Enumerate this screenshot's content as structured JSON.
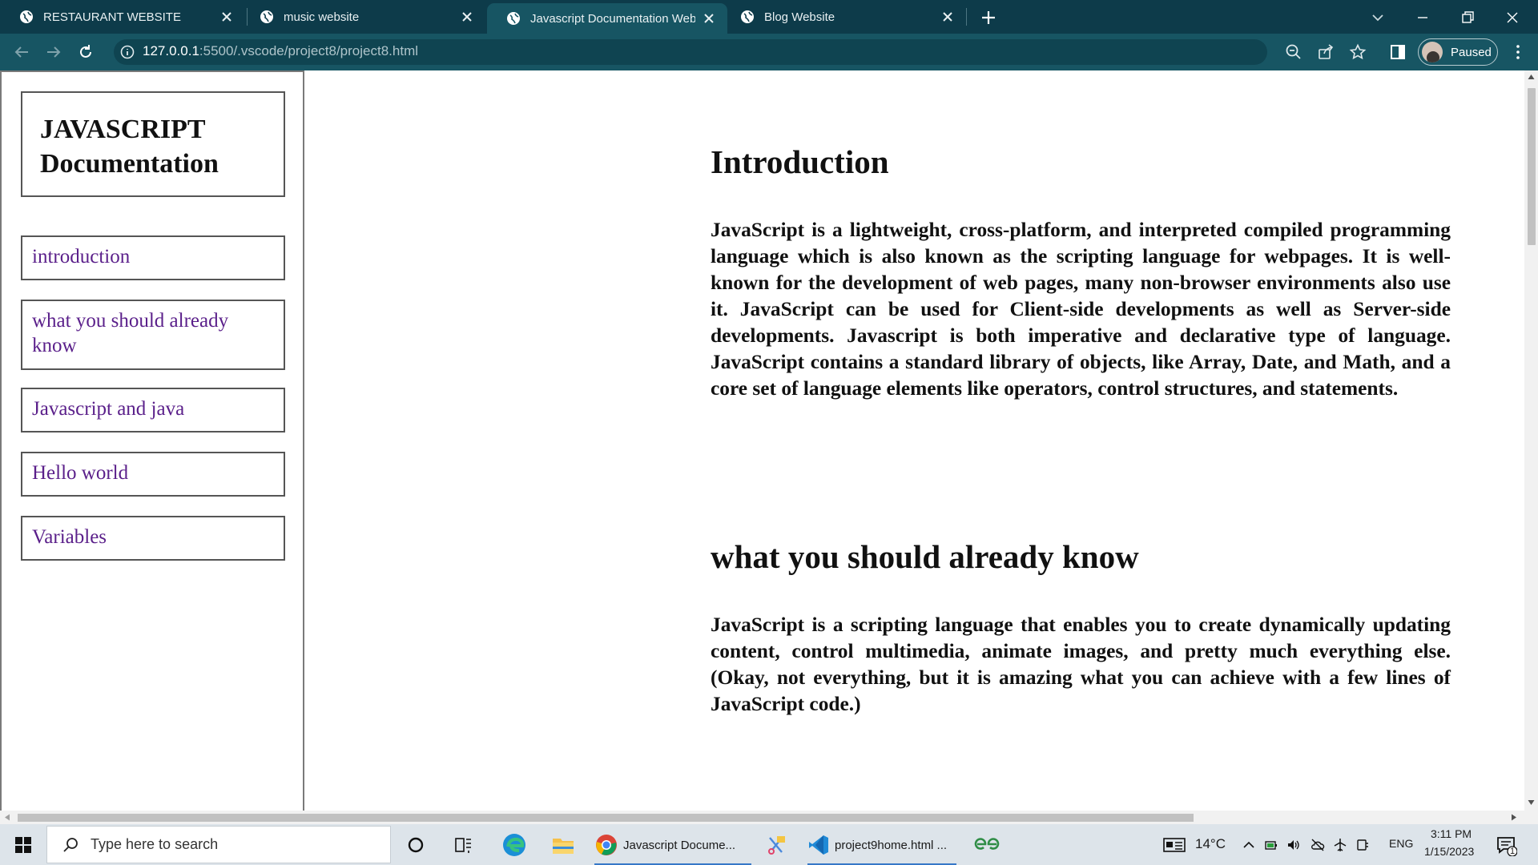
{
  "browser": {
    "tabs": [
      {
        "title": "RESTAURANT WEBSITE",
        "active": false
      },
      {
        "title": "music website",
        "active": false
      },
      {
        "title": "Javascript Documentation Websi",
        "active": true
      },
      {
        "title": "Blog Website",
        "active": false
      }
    ],
    "url": {
      "host": "127.0.0.1",
      "path": ":5500/.vscode/project8/project8.html"
    },
    "profile_status": "Paused",
    "theme_color": "#0d3b4a"
  },
  "sidebar": {
    "title": "JAVASCRIPT Documentation",
    "links": [
      {
        "label": "introduction"
      },
      {
        "label": "what you should already know"
      },
      {
        "label": "Javascript and java"
      },
      {
        "label": "Hello world"
      },
      {
        "label": "Variables"
      }
    ],
    "link_color": "#5a1f8a"
  },
  "content": {
    "sections": [
      {
        "heading": "Introduction",
        "body": "JavaScript is a lightweight, cross-platform, and interpreted compiled programming language which is also known as the scripting language for webpages. It is well-known for the development of web pages, many non-browser environments also use it. JavaScript can be used for Client-side developments as well as Server-side developments. Javascript is both imperative and declarative type of language. JavaScript contains a standard library of objects, like Array, Date, and Math, and a core set of language elements like operators, control structures, and statements."
      },
      {
        "heading": "what you should already know",
        "body": "JavaScript is a scripting language that enables you to create dynamically updating content, control multimedia, animate images, and pretty much everything else. (Okay, not everything, but it is amazing what you can achieve with a few lines of JavaScript code.)"
      }
    ]
  },
  "taskbar": {
    "search_placeholder": "Type here to search",
    "apps": [
      {
        "label": "Javascript Docume...",
        "icon": "chrome-icon"
      },
      {
        "label": "project9home.html ...",
        "icon": "vscode-icon"
      }
    ],
    "weather": "14°C",
    "language": "ENG",
    "time": "3:11 PM",
    "date": "1/15/2023",
    "notification_count": "1"
  }
}
